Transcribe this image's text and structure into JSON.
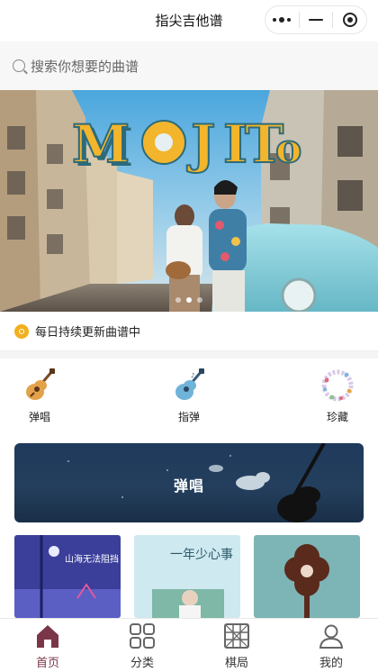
{
  "navbar": {
    "title": "指尖吉他谱"
  },
  "search": {
    "placeholder": "搜索你想要的曲谱"
  },
  "banner": {
    "art_title": "MOJITO",
    "slide_count": 3,
    "active_slide": 2
  },
  "notice": {
    "text": "每日持续更新曲谱中"
  },
  "categories": [
    {
      "label": "弹唱",
      "icon": "guitar-icon"
    },
    {
      "label": "指弹",
      "icon": "fingerstyle-guitar-icon"
    },
    {
      "label": "珍藏",
      "icon": "flower-wreath-icon"
    }
  ],
  "feature": {
    "title": "弹唱"
  },
  "thumbs": [
    {
      "caption": "山海无法阻挡"
    },
    {
      "caption": "一年少心事"
    },
    {
      "caption": ""
    }
  ],
  "tabbar": {
    "items": [
      {
        "label": "首页",
        "icon": "home-icon",
        "active": true
      },
      {
        "label": "分类",
        "icon": "category-grid-icon",
        "active": false
      },
      {
        "label": "棋局",
        "icon": "chessboard-icon",
        "active": false
      },
      {
        "label": "我的",
        "icon": "user-icon",
        "active": false
      }
    ]
  },
  "colors": {
    "accent": "#7a3648",
    "notice_icon": "#f2b01e",
    "feature_bg": "#1f3a5c"
  }
}
